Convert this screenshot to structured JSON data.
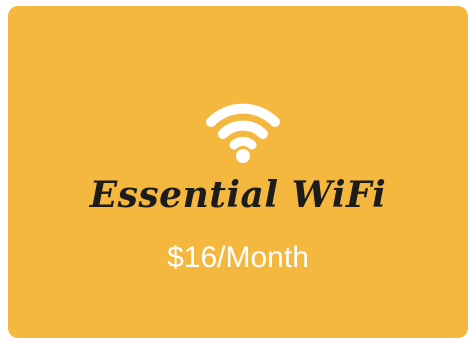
{
  "plan": {
    "icon": "wifi-icon",
    "name": "Essential WiFi",
    "price": "$16/Month"
  },
  "colors": {
    "card_background": "#f5b83f",
    "title_text": "#1c1c1c",
    "price_text": "#ffffff",
    "icon": "#ffffff"
  }
}
